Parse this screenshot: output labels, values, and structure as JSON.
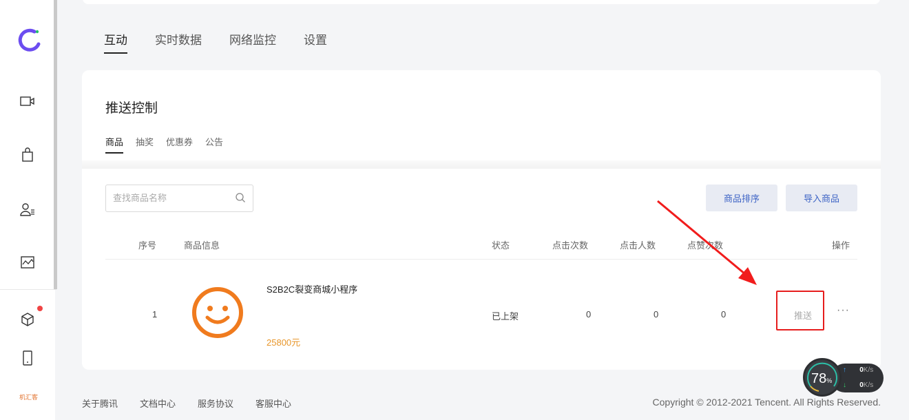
{
  "sidebar": {
    "brand": "brand-logo",
    "items": [
      "video-icon",
      "bag-icon",
      "user-list-icon",
      "chart-icon"
    ],
    "bottom_items": [
      "cube-icon",
      "phone-icon"
    ],
    "bottom_logo": "机汇客"
  },
  "main_tabs": [
    "互动",
    "实时数据",
    "网络监控",
    "设置"
  ],
  "card": {
    "title": "推送控制",
    "sub_tabs": [
      "商品",
      "抽奖",
      "优惠券",
      "公告"
    ],
    "search_placeholder": "查找商品名称",
    "sort_button": "商品排序",
    "import_button": "导入商品"
  },
  "table": {
    "headers": {
      "index": "序号",
      "info": "商品信息",
      "status": "状态",
      "clicks": "点击次数",
      "clickers": "点击人数",
      "purchases": "点赞次数",
      "actions": "操作"
    },
    "rows": [
      {
        "index": "1",
        "name": "S2B2C裂变商城小程序",
        "price": "25800元",
        "status": "已上架",
        "clicks": "0",
        "clickers": "0",
        "purchases": "0",
        "push": "推送",
        "more": "···"
      }
    ]
  },
  "footer": {
    "links": [
      "关于腾讯",
      "文档中心",
      "服务协议",
      "客服中心"
    ],
    "copyright": "Copyright © 2012-2021 Tencent. All Rights Reserved."
  },
  "speed_widget": {
    "percent": "78",
    "percent_unit": "%",
    "upload": "0",
    "download": "0",
    "unit": "K/s"
  },
  "colors": {
    "accent": "#3d63c5",
    "price": "#e8962a",
    "highlight": "#e61c1c",
    "smiley": "#f07b1e"
  }
}
